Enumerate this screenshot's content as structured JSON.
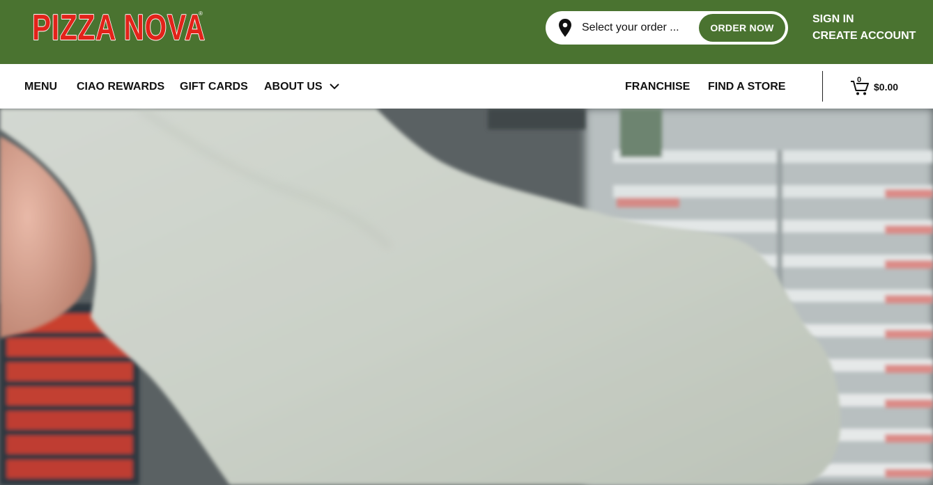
{
  "brand": {
    "logo_text": "PIZZA NOVA",
    "registered_mark": "®"
  },
  "order": {
    "placeholder": "Select your order ...",
    "button_label": "ORDER NOW",
    "icon": "location-pin-icon"
  },
  "account": {
    "sign_in": "SIGN IN",
    "create_account": "CREATE ACCOUNT"
  },
  "nav": {
    "menu": "MENU",
    "ciao_rewards": "CIAO REWARDS",
    "gift_cards": "GIFT CARDS",
    "about_us": "ABOUT US",
    "franchise": "FRANCHISE",
    "find_a_store": "FIND A STORE"
  },
  "cart": {
    "count": "0",
    "total": "$0.00",
    "icon": "shopping-cart-icon"
  },
  "colors": {
    "brand_green": "#4a7330",
    "logo_red": "#e2231a"
  }
}
